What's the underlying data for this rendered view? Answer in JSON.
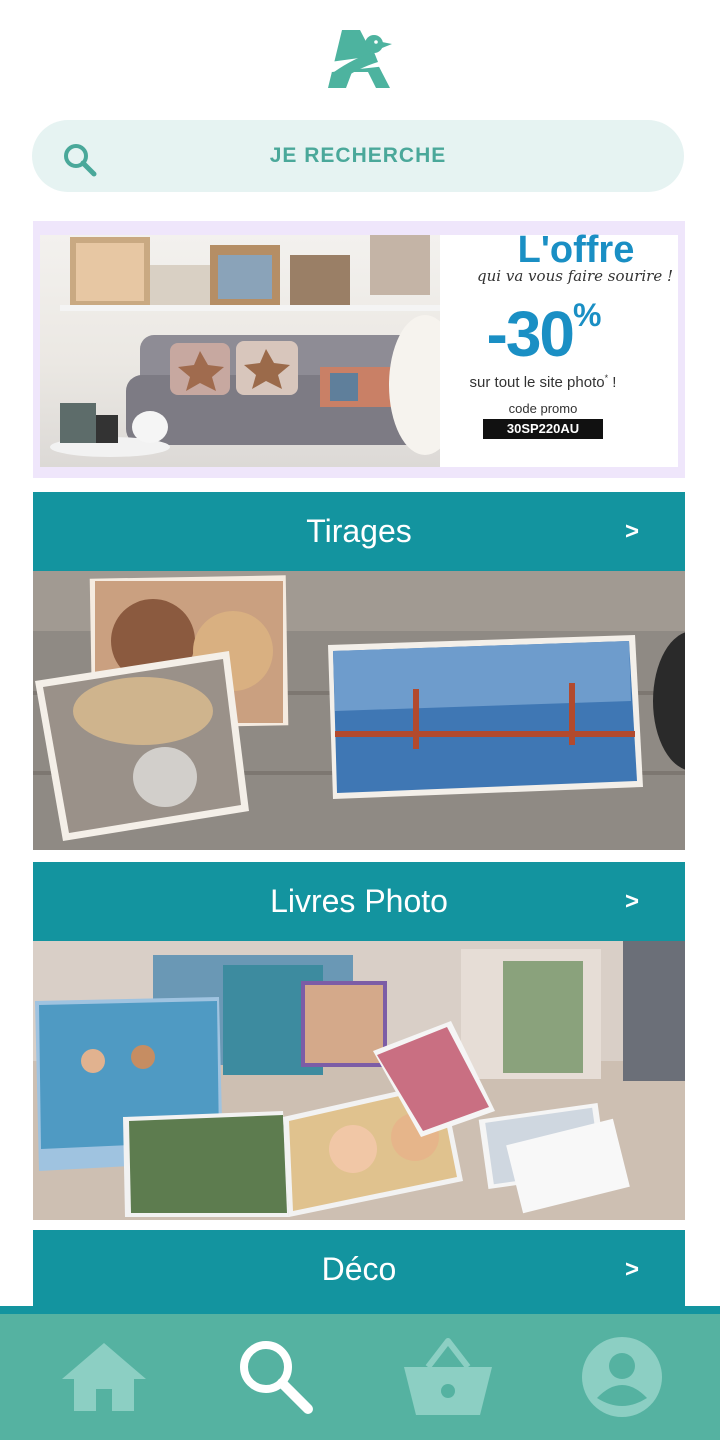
{
  "header": {
    "logo_icon": "auchan-bird-logo-icon"
  },
  "search": {
    "placeholder": "JE RECHERCHE",
    "icon": "search-icon"
  },
  "promo_banner": {
    "title": "L'offre",
    "subtitle": "qui va vous faire sourire !",
    "discount": "-30",
    "percent": "%",
    "line": "sur tout le site photo",
    "line_mark": "*",
    "line_end": " !",
    "code_label": "code promo",
    "code": "30SP220AU"
  },
  "categories": [
    {
      "label": "Tirages",
      "chevron": ">"
    },
    {
      "label": "Livres Photo",
      "chevron": ">"
    },
    {
      "label": "Déco",
      "chevron": ">"
    }
  ],
  "bottom_nav": {
    "items": [
      {
        "icon": "home-icon",
        "active": false
      },
      {
        "icon": "search-icon",
        "active": true
      },
      {
        "icon": "basket-icon",
        "active": false
      },
      {
        "icon": "account-icon",
        "active": false
      }
    ]
  },
  "colors": {
    "brand_teal": "#13949f",
    "nav_green": "#55b2a1",
    "search_bg": "#e6f3f2",
    "search_text": "#4aa89a",
    "promo_blue": "#1a8fc4"
  }
}
